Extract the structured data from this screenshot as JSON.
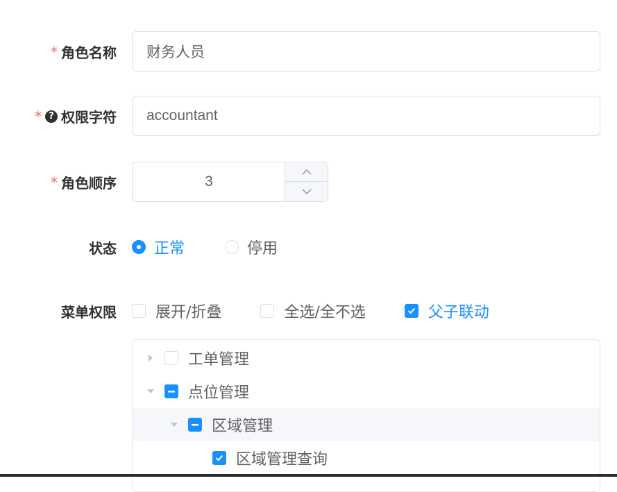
{
  "form": {
    "role_name": {
      "required": "*",
      "label": "角色名称",
      "value": "财务人员"
    },
    "permission_key": {
      "required": "*",
      "help_icon": "question-circle-icon",
      "label": "权限字符",
      "value": "accountant"
    },
    "role_order": {
      "required": "*",
      "label": "角色顺序",
      "value": "3"
    },
    "status": {
      "label": "状态",
      "options": [
        {
          "label": "正常",
          "checked": true
        },
        {
          "label": "停用",
          "checked": false
        }
      ]
    },
    "menu_permission": {
      "label": "菜单权限",
      "options": [
        {
          "label": "展开/折叠",
          "checked": false
        },
        {
          "label": "全选/全不选",
          "checked": false
        },
        {
          "label": "父子联动",
          "checked": true
        }
      ],
      "tree": [
        {
          "label": "工单管理",
          "state": "unchecked",
          "expanded": false
        },
        {
          "label": "点位管理",
          "state": "indeterminate",
          "expanded": true
        },
        {
          "label": "区域管理",
          "state": "indeterminate",
          "expanded": true
        },
        {
          "label": "区域管理查询",
          "state": "checked"
        }
      ]
    }
  },
  "colors": {
    "primary": "#1890ff",
    "required": "#f56c6c",
    "border": "#dcdfe6"
  }
}
